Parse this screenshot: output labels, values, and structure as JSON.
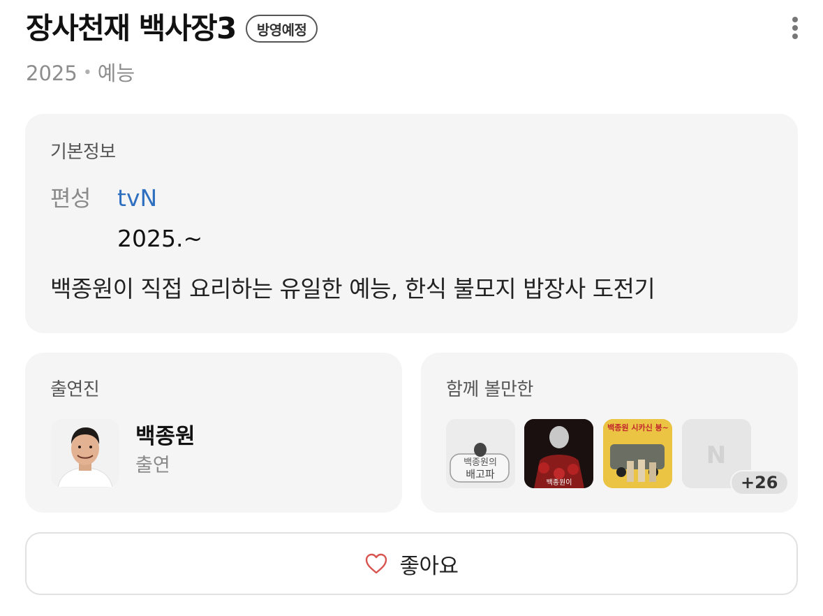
{
  "header": {
    "title": "장사천재 백사장3",
    "badge": "방영예정",
    "year": "2025",
    "separator": "•",
    "genre": "예능"
  },
  "basic_info": {
    "heading": "기본정보",
    "field_label": "편성",
    "channel": "tvN",
    "period": "2025.~",
    "synopsis": "백종원이 직접 요리하는 유일한 예능, 한식 불모지 밥장사 도전기"
  },
  "cast": {
    "heading": "출연진",
    "members": [
      {
        "name": "백종원",
        "role": "출연"
      }
    ]
  },
  "recommendations": {
    "heading": "함께 볼만한",
    "items": [
      {
        "thumb_text": "백종원의 배고파"
      },
      {
        "thumb_text": "백종원이"
      },
      {
        "thumb_text": "백종원 시카신 붕~"
      },
      {
        "thumb_text": "N"
      }
    ],
    "more_count": "+26"
  },
  "like": {
    "label": "좋아요"
  },
  "colors": {
    "accent_link": "#2f6fc0",
    "heart": "#d9534f",
    "card_bg": "#f5f5f5"
  }
}
